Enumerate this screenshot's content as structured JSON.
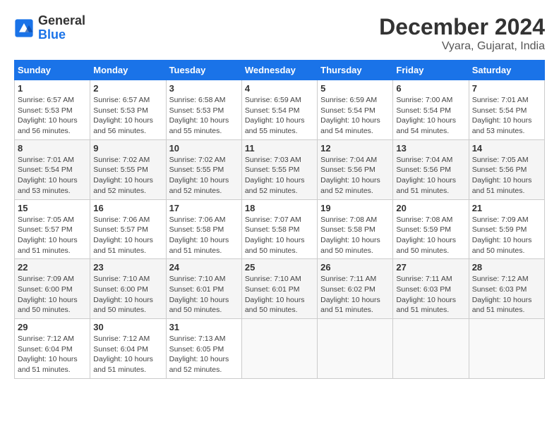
{
  "header": {
    "logo_general": "General",
    "logo_blue": "Blue",
    "title": "December 2024",
    "subtitle": "Vyara, Gujarat, India"
  },
  "calendar": {
    "weekdays": [
      "Sunday",
      "Monday",
      "Tuesday",
      "Wednesday",
      "Thursday",
      "Friday",
      "Saturday"
    ],
    "weeks": [
      [
        {
          "day": "",
          "info": ""
        },
        {
          "day": "2",
          "info": "Sunrise: 6:57 AM\nSunset: 5:53 PM\nDaylight: 10 hours\nand 56 minutes."
        },
        {
          "day": "3",
          "info": "Sunrise: 6:58 AM\nSunset: 5:53 PM\nDaylight: 10 hours\nand 55 minutes."
        },
        {
          "day": "4",
          "info": "Sunrise: 6:59 AM\nSunset: 5:54 PM\nDaylight: 10 hours\nand 55 minutes."
        },
        {
          "day": "5",
          "info": "Sunrise: 6:59 AM\nSunset: 5:54 PM\nDaylight: 10 hours\nand 54 minutes."
        },
        {
          "day": "6",
          "info": "Sunrise: 7:00 AM\nSunset: 5:54 PM\nDaylight: 10 hours\nand 54 minutes."
        },
        {
          "day": "7",
          "info": "Sunrise: 7:01 AM\nSunset: 5:54 PM\nDaylight: 10 hours\nand 53 minutes."
        }
      ],
      [
        {
          "day": "1",
          "info": "Sunrise: 6:57 AM\nSunset: 5:53 PM\nDaylight: 10 hours\nand 56 minutes."
        },
        {
          "day": "9",
          "info": "Sunrise: 7:02 AM\nSunset: 5:55 PM\nDaylight: 10 hours\nand 52 minutes."
        },
        {
          "day": "10",
          "info": "Sunrise: 7:02 AM\nSunset: 5:55 PM\nDaylight: 10 hours\nand 52 minutes."
        },
        {
          "day": "11",
          "info": "Sunrise: 7:03 AM\nSunset: 5:55 PM\nDaylight: 10 hours\nand 52 minutes."
        },
        {
          "day": "12",
          "info": "Sunrise: 7:04 AM\nSunset: 5:56 PM\nDaylight: 10 hours\nand 52 minutes."
        },
        {
          "day": "13",
          "info": "Sunrise: 7:04 AM\nSunset: 5:56 PM\nDaylight: 10 hours\nand 51 minutes."
        },
        {
          "day": "14",
          "info": "Sunrise: 7:05 AM\nSunset: 5:56 PM\nDaylight: 10 hours\nand 51 minutes."
        }
      ],
      [
        {
          "day": "8",
          "info": "Sunrise: 7:01 AM\nSunset: 5:54 PM\nDaylight: 10 hours\nand 53 minutes."
        },
        {
          "day": "16",
          "info": "Sunrise: 7:06 AM\nSunset: 5:57 PM\nDaylight: 10 hours\nand 51 minutes."
        },
        {
          "day": "17",
          "info": "Sunrise: 7:06 AM\nSunset: 5:58 PM\nDaylight: 10 hours\nand 51 minutes."
        },
        {
          "day": "18",
          "info": "Sunrise: 7:07 AM\nSunset: 5:58 PM\nDaylight: 10 hours\nand 50 minutes."
        },
        {
          "day": "19",
          "info": "Sunrise: 7:08 AM\nSunset: 5:58 PM\nDaylight: 10 hours\nand 50 minutes."
        },
        {
          "day": "20",
          "info": "Sunrise: 7:08 AM\nSunset: 5:59 PM\nDaylight: 10 hours\nand 50 minutes."
        },
        {
          "day": "21",
          "info": "Sunrise: 7:09 AM\nSunset: 5:59 PM\nDaylight: 10 hours\nand 50 minutes."
        }
      ],
      [
        {
          "day": "15",
          "info": "Sunrise: 7:05 AM\nSunset: 5:57 PM\nDaylight: 10 hours\nand 51 minutes."
        },
        {
          "day": "23",
          "info": "Sunrise: 7:10 AM\nSunset: 6:00 PM\nDaylight: 10 hours\nand 50 minutes."
        },
        {
          "day": "24",
          "info": "Sunrise: 7:10 AM\nSunset: 6:01 PM\nDaylight: 10 hours\nand 50 minutes."
        },
        {
          "day": "25",
          "info": "Sunrise: 7:10 AM\nSunset: 6:01 PM\nDaylight: 10 hours\nand 50 minutes."
        },
        {
          "day": "26",
          "info": "Sunrise: 7:11 AM\nSunset: 6:02 PM\nDaylight: 10 hours\nand 51 minutes."
        },
        {
          "day": "27",
          "info": "Sunrise: 7:11 AM\nSunset: 6:03 PM\nDaylight: 10 hours\nand 51 minutes."
        },
        {
          "day": "28",
          "info": "Sunrise: 7:12 AM\nSunset: 6:03 PM\nDaylight: 10 hours\nand 51 minutes."
        }
      ],
      [
        {
          "day": "22",
          "info": "Sunrise: 7:09 AM\nSunset: 6:00 PM\nDaylight: 10 hours\nand 50 minutes."
        },
        {
          "day": "30",
          "info": "Sunrise: 7:12 AM\nSunset: 6:04 PM\nDaylight: 10 hours\nand 51 minutes."
        },
        {
          "day": "31",
          "info": "Sunrise: 7:13 AM\nSunset: 6:05 PM\nDaylight: 10 hours\nand 52 minutes."
        },
        {
          "day": "",
          "info": ""
        },
        {
          "day": "",
          "info": ""
        },
        {
          "day": "",
          "info": ""
        },
        {
          "day": "",
          "info": ""
        }
      ],
      [
        {
          "day": "29",
          "info": "Sunrise: 7:12 AM\nSunset: 6:04 PM\nDaylight: 10 hours\nand 51 minutes."
        },
        {
          "day": "",
          "info": ""
        },
        {
          "day": "",
          "info": ""
        },
        {
          "day": "",
          "info": ""
        },
        {
          "day": "",
          "info": ""
        },
        {
          "day": "",
          "info": ""
        },
        {
          "day": "",
          "info": ""
        }
      ]
    ]
  }
}
